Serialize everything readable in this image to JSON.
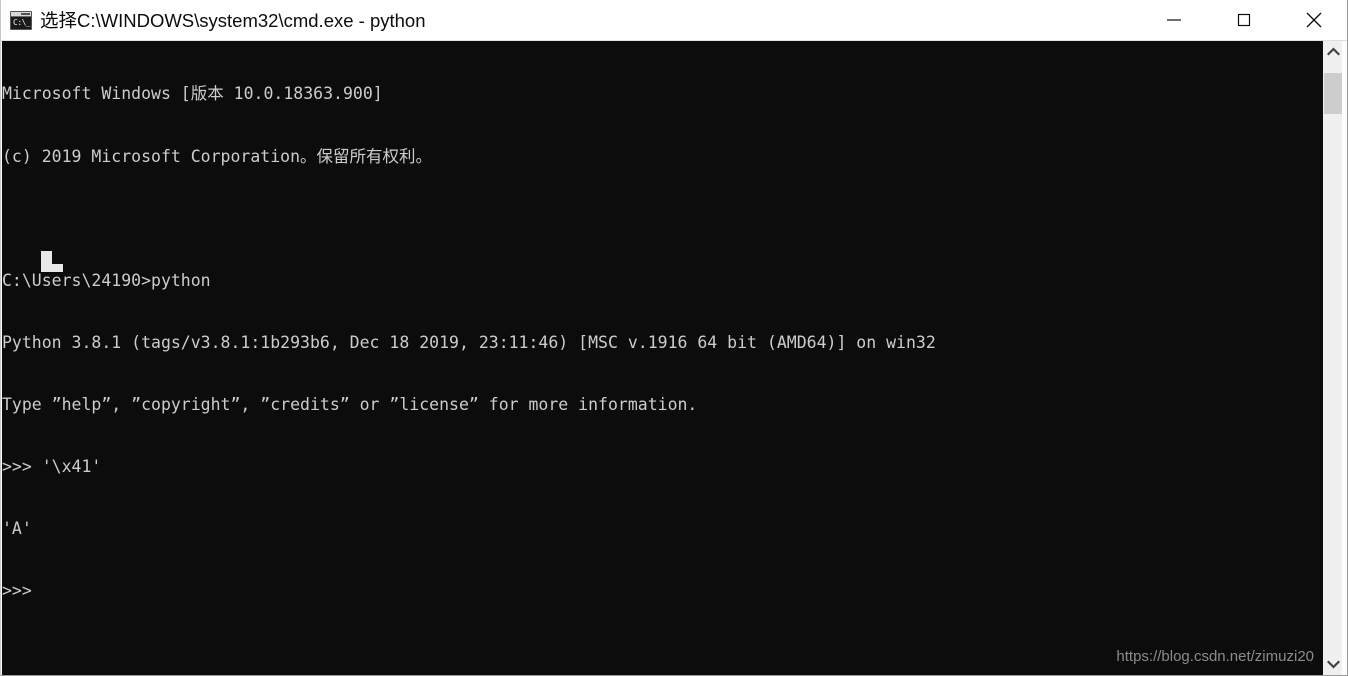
{
  "window": {
    "title": "选择C:\\WINDOWS\\system32\\cmd.exe - python",
    "icon_name": "cmd-exe-icon",
    "icon_glyph": "C:\\_",
    "background_color": "#0c0c0c",
    "foreground_color": "#cccccc",
    "titlebar_color": "#ffffff",
    "controls": {
      "minimize_label": "—",
      "maximize_label": "□",
      "close_label": "✕"
    }
  },
  "console": {
    "lines": [
      "Microsoft Windows [版本 10.0.18363.900]",
      "(c) 2019 Microsoft Corporation。保留所有权利。",
      "",
      "C:\\Users\\24190>python",
      "Python 3.8.1 (tags/v3.8.1:1b293b6, Dec 18 2019, 23:11:46) [MSC v.1916 64 bit (AMD64)] on win32",
      "Type ”help”, ”copyright”, ”credits” or ”license” for more information.",
      ">>> '\\x41'",
      "'A'",
      ">>>"
    ],
    "cursor": "block-cursor"
  },
  "watermark": {
    "text": "https://blog.csdn.net/zimuzi20"
  },
  "scrollbar": {
    "up_arrow": "chevron-up-icon",
    "down_arrow": "chevron-down-icon",
    "thumb_color": "#cdcdcd",
    "track_color": "#f0f0f0"
  }
}
